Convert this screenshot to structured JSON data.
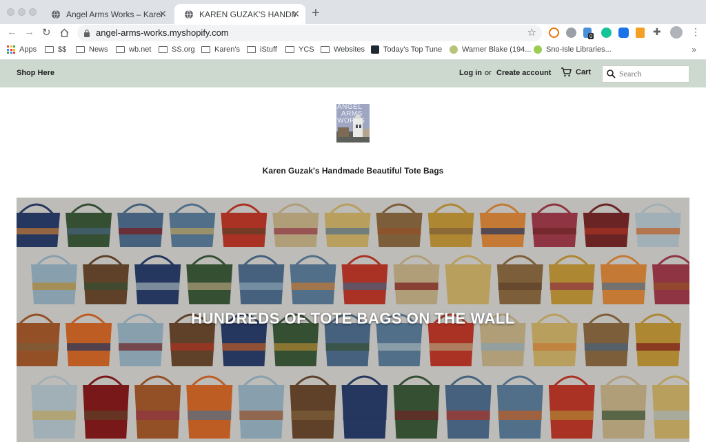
{
  "browser": {
    "tabs": [
      {
        "title": "Angel Arms Works – Karen Guzak Handmade Tote Bags",
        "active": false
      },
      {
        "title": "KAREN GUZAK'S HANDMADE BEAUTIFUL TOTE BAGS",
        "active": true
      }
    ],
    "url": "angel-arms-works.myshopify.com",
    "extension_badge": "0",
    "bookmarks": [
      {
        "label": "Apps",
        "icon": "apps-grid-icon"
      },
      {
        "label": "$$",
        "icon": "folder-icon"
      },
      {
        "label": "News",
        "icon": "folder-icon"
      },
      {
        "label": "wb.net",
        "icon": "folder-icon"
      },
      {
        "label": "SS.org",
        "icon": "folder-icon"
      },
      {
        "label": "Karen's",
        "icon": "folder-icon"
      },
      {
        "label": "iStuff",
        "icon": "folder-icon"
      },
      {
        "label": "YCS",
        "icon": "folder-icon"
      },
      {
        "label": "Websites",
        "icon": "folder-icon"
      },
      {
        "label": "Today's Top Tune",
        "icon": "site-icon"
      },
      {
        "label": "Warner Blake (194...",
        "icon": "site-icon"
      },
      {
        "label": "Sno-Isle Libraries...",
        "icon": "site-icon"
      }
    ]
  },
  "site": {
    "nav_shop": "Shop Here",
    "login": "Log in",
    "or": "or",
    "create_account": "Create account",
    "cart": "Cart",
    "search_placeholder": "Search",
    "logo_text": [
      "ANGEL",
      "ARMS",
      "WORKS"
    ],
    "tagline": "Karen Guzak's Handmade Beautiful Tote Bags",
    "hero_title": "HUNDREDS OF TOTE BAGS ON THE WALL",
    "colors": {
      "header_bg": "#cdd8cf",
      "text": "#1c1d1d",
      "logo_bg": "#9fa6c2"
    }
  }
}
